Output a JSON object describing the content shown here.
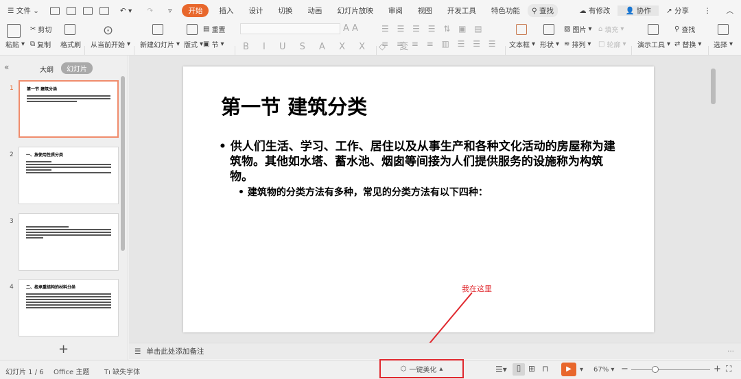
{
  "menu": {
    "file": "文件"
  },
  "tabs": [
    "开始",
    "插入",
    "设计",
    "切换",
    "动画",
    "幻灯片放映",
    "审阅",
    "视图",
    "开发工具",
    "特色功能"
  ],
  "search_tab": "查找",
  "right_actions": {
    "modified": "有修改",
    "collab": "协作",
    "share": "分享"
  },
  "ribbon": {
    "paste": "粘贴",
    "cut": "剪切",
    "copy": "复制",
    "format_painter": "格式刷",
    "from_current": "从当前开始",
    "new_slide": "新建幻灯片",
    "layout": "版式",
    "reset": "重置",
    "section": "节",
    "text_box": "文本框",
    "shape": "形状",
    "picture": "图片",
    "fill": "填充",
    "arrange": "排列",
    "outline": "轮廓",
    "present_tools": "演示工具",
    "find": "查找",
    "replace": "替换",
    "select": "选择"
  },
  "left_panel": {
    "outline_tab": "大纲",
    "slides_tab": "幻灯片",
    "add": "+",
    "slides": [
      {
        "num": "1",
        "title": "第一节 建筑分类"
      },
      {
        "num": "2",
        "title": "一、按使用性质分类"
      },
      {
        "num": "3",
        "title": ""
      },
      {
        "num": "4",
        "title": "二、按承重结构的材料分类"
      }
    ]
  },
  "slide": {
    "title": "第一节 建筑分类",
    "bullet1": "供人们生活、学习、工作、居住以及从事生产和各种文化活动的房屋称为建筑物。其他如水塔、蓄水池、烟囱等间接为人们提供服务的设施称为构筑物。",
    "bullet2": "建筑物的分类方法有多种，常见的分类方法有以下四种："
  },
  "annotation": {
    "text": "我在这里",
    "color": "#e0282e"
  },
  "notes_placeholder": "单击此处添加备注",
  "status": {
    "slide_info": "幻灯片 1 / 6",
    "theme": "Office 主题",
    "missing_font": "缺失字体",
    "beautify": "一键美化",
    "zoom": "67%"
  },
  "accent": "#e8672c"
}
